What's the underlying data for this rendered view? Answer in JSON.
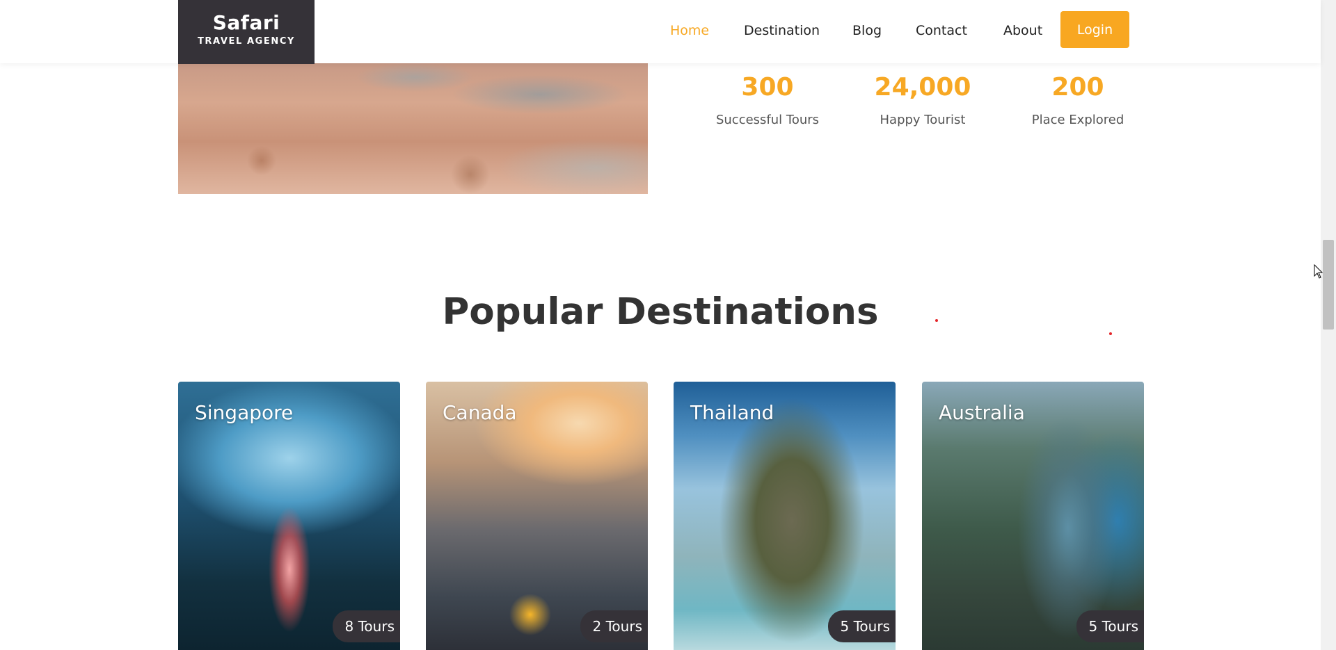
{
  "header": {
    "logo": {
      "title": "Safari",
      "subtitle": "TRAVEL AGENCY"
    },
    "nav": [
      {
        "label": "Home",
        "active": true
      },
      {
        "label": "Destination",
        "active": false
      },
      {
        "label": "Blog",
        "active": false
      },
      {
        "label": "Contact",
        "active": false
      },
      {
        "label": "About",
        "active": false
      }
    ],
    "login_label": "Login"
  },
  "stats": [
    {
      "value": "300",
      "label": "Successful Tours"
    },
    {
      "value": "24,000",
      "label": "Happy Tourist"
    },
    {
      "value": "200",
      "label": "Place Explored"
    }
  ],
  "popular": {
    "title": "Popular Destinations",
    "cards": [
      {
        "name": "Singapore",
        "tours": "8 Tours"
      },
      {
        "name": "Canada",
        "tours": "2 Tours"
      },
      {
        "name": "Thailand",
        "tours": "5 Tours"
      },
      {
        "name": "Australia",
        "tours": "5 Tours"
      }
    ]
  },
  "colors": {
    "accent": "#f7a824",
    "dark": "#353238",
    "text": "#333333"
  }
}
